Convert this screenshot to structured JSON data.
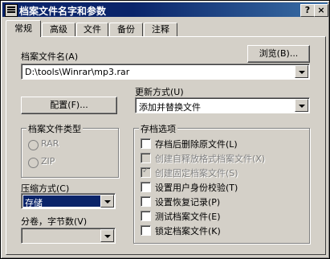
{
  "window": {
    "title": "档案文件名字和参数",
    "help_label": "?",
    "close_label": "×"
  },
  "tabs": [
    "常规",
    "高级",
    "文件",
    "备份",
    "注释"
  ],
  "archive_name": {
    "label": "档案文件名(A)",
    "value": "D:\\tools\\Winrar\\mp3.rar",
    "browse_label": "浏览(B)..."
  },
  "update_mode": {
    "label": "更新方式(U)",
    "value": "添加并替换文件"
  },
  "config_label": "配置(F)...",
  "archive_type": {
    "title": "档案文件类型",
    "options": [
      "RAR",
      "ZIP"
    ]
  },
  "compression": {
    "label": "压缩方式(C)",
    "value": "存储"
  },
  "volume": {
    "label": "分卷，字节数(V)",
    "value": ""
  },
  "archive_options": {
    "title": "存档选项",
    "items": [
      {
        "label": "存档后删除原文件(L)",
        "checked": false,
        "disabled": false
      },
      {
        "label": "创建自释放格式档案文件(X)",
        "checked": false,
        "disabled": true
      },
      {
        "label": "创建固定档案文件(S)",
        "checked": true,
        "disabled": true
      },
      {
        "label": "设置用户身份校验(T)",
        "checked": false,
        "disabled": false
      },
      {
        "label": "设置恢复记录(P)",
        "checked": false,
        "disabled": false
      },
      {
        "label": "测试档案文件(E)",
        "checked": false,
        "disabled": false
      },
      {
        "label": "锁定档案文件(K)",
        "checked": false,
        "disabled": false
      }
    ]
  },
  "colors": {
    "titlebar": "#0a246a",
    "face": "#d4d0c8",
    "selection": "#0a246a"
  }
}
